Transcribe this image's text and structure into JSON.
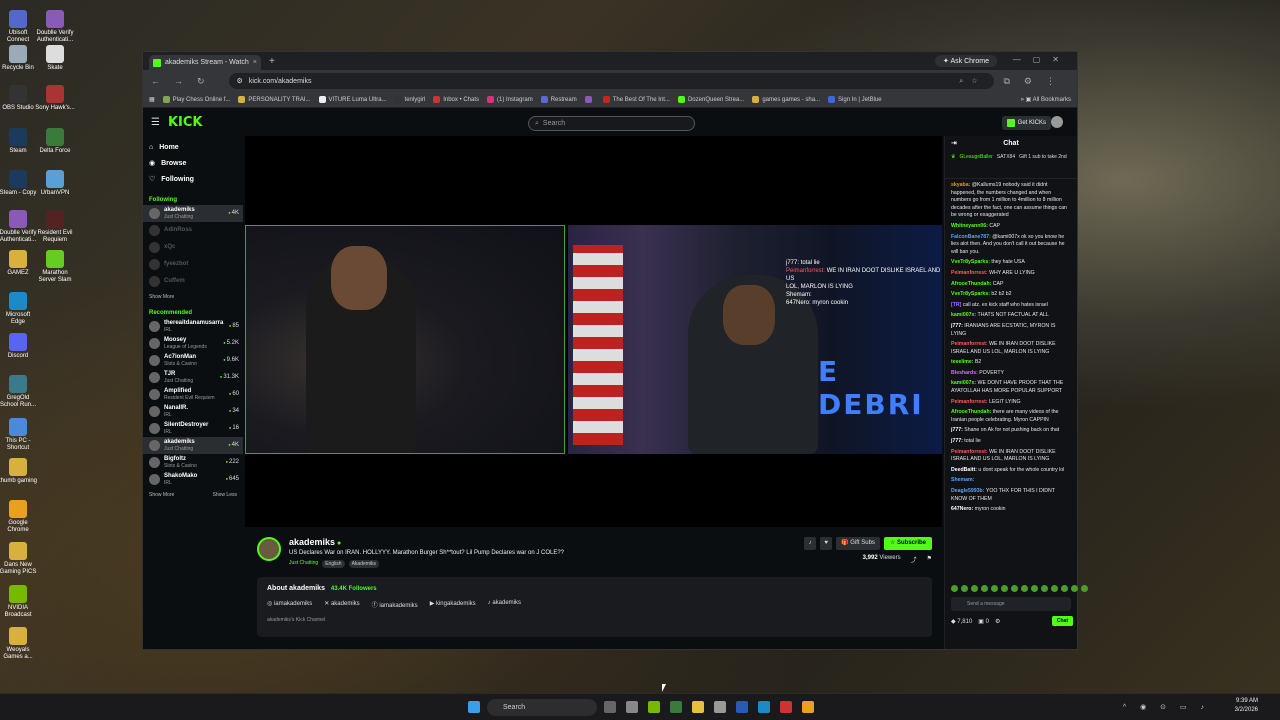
{
  "desktop_icons": [
    {
      "label": "Ubisoft Connect",
      "color": "#5468c9"
    },
    {
      "label": "Doublle Verify Authenticati...",
      "color": "#8a5ab8"
    },
    {
      "label": "Recycle Bin",
      "color": "#9aaab8"
    },
    {
      "label": "Skate",
      "color": "#ddd"
    },
    {
      "label": "OBS Studio",
      "color": "#333"
    },
    {
      "label": "Sony Hawk's...",
      "color": "#aa3333"
    },
    {
      "label": "Steam",
      "color": "#1b3a5c"
    },
    {
      "label": "Delta Force",
      "color": "#3a7a3a"
    },
    {
      "label": "Steam - Copy",
      "color": "#1b3a5c"
    },
    {
      "label": "UrbanVPN",
      "color": "#5aa0d8"
    },
    {
      "label": "Doublle Verify Authenticati...",
      "color": "#8a5ab8"
    },
    {
      "label": "Resident Evil Requiem",
      "color": "#552222"
    },
    {
      "label": "GAMEZ",
      "color": "#d8b040"
    },
    {
      "label": "Marathon Server Slam",
      "color": "#66cc22"
    },
    {
      "label": "Microsoft Edge",
      "color": "#1d8ac8"
    },
    {
      "label": "Discord",
      "color": "#5865f2"
    },
    {
      "label": "GregOld School Run...",
      "color": "#3a7a8a"
    },
    {
      "label": "This PC - Shortcut",
      "color": "#4a8ad8"
    },
    {
      "label": "thumb gaming",
      "color": "#d8b040"
    },
    {
      "label": "Google Chrome",
      "color": "#e8a020"
    },
    {
      "label": "Dans New Gaming PICS",
      "color": "#d8b040"
    },
    {
      "label": "NVIDIA Broadcast",
      "color": "#76b900"
    },
    {
      "label": "Weoyals Games a...",
      "color": "#d8b040"
    }
  ],
  "browser": {
    "tab_title": "akademiks Stream - Watch",
    "ask_chrome": "Ask Chrome",
    "url": "kick.com/akademiks",
    "bookmarks": [
      {
        "label": "Play Chess Online f...",
        "color": "#7fa650"
      },
      {
        "label": "PERSONALITY TRAI...",
        "color": "#d8b040"
      },
      {
        "label": "VITURE Luma Ultra...",
        "color": "#eee"
      },
      {
        "label": "tenlygirl",
        "color": "#333"
      },
      {
        "label": "Inbox • Chats",
        "color": "#c33"
      },
      {
        "label": "(1) Instagram",
        "color": "#d6337a"
      },
      {
        "label": "Restream",
        "color": "#5a6ad8"
      },
      {
        "label": "",
        "color": "#8a5ab8"
      },
      {
        "label": "The Best Of The Int...",
        "color": "#c22"
      },
      {
        "label": "DozenQueen Strea...",
        "color": "#53fc18"
      },
      {
        "label": "games games - sha...",
        "color": "#d8b040"
      },
      {
        "label": "Sign In | JetBlue",
        "color": "#3a6ad8"
      }
    ],
    "all_bookmarks": "All Bookmarks"
  },
  "kick": {
    "logo": "KICK",
    "search_placeholder": "Search",
    "get_kicks": "Get KICKs",
    "nav": {
      "home": "Home",
      "browse": "Browse",
      "following": "Following"
    },
    "following_header": "Following",
    "following": [
      {
        "name": "akademiks",
        "cat": "Just Chatting",
        "viewers": "4K",
        "dim": false
      },
      {
        "name": "AdinRoss",
        "cat": "",
        "viewers": "",
        "dim": true
      },
      {
        "name": "xQc",
        "cat": "",
        "viewers": "",
        "dim": true
      },
      {
        "name": "fyeezbot",
        "cat": "",
        "viewers": "",
        "dim": true
      },
      {
        "name": "Cuffem",
        "cat": "",
        "viewers": "",
        "dim": true
      }
    ],
    "show_more": "Show More",
    "recommended_header": "Recommended",
    "recommended": [
      {
        "name": "thereaitdanamusarra",
        "cat": "IRL",
        "viewers": "85"
      },
      {
        "name": "Moosey",
        "cat": "League of Legends",
        "viewers": "5.2K"
      },
      {
        "name": "Ac7ionMan",
        "cat": "Slots & Casino",
        "viewers": "9.6K"
      },
      {
        "name": "TJR",
        "cat": "Just Chatting",
        "viewers": "31.3K"
      },
      {
        "name": "Amplified",
        "cat": "Resident Evil Requiem",
        "viewers": "60"
      },
      {
        "name": "NanaIIR.",
        "cat": "IRL",
        "viewers": "34"
      },
      {
        "name": "SilentDestroyer",
        "cat": "IRL",
        "viewers": "16"
      },
      {
        "name": "akademiks",
        "cat": "Just Chatting",
        "viewers": "4K"
      },
      {
        "name": "Bigfoltz",
        "cat": "Slots & Casino",
        "viewers": "222"
      },
      {
        "name": "ShakoMako",
        "cat": "IRL",
        "viewers": "645"
      }
    ],
    "show_more2": "Show More",
    "show_less": "Show Less",
    "overlay": {
      "l1": "j777: total lie",
      "l2a": "Peimanforrest:",
      "l2b": "WE IN IRAN DOOT DISLIKE ISRAEL AND US",
      "l3": "LOL, MARLON IS LYING",
      "l4": "Shemam:",
      "l5": "647Nero: myron cookin"
    },
    "neon_text": "E DEBRI",
    "streamer": "akademiks",
    "title": "US Declares War on IRAN. HOLLYYY. Marathon Burger Sh**tout? Lil Pump Declares war on J COLE??",
    "category": "Just Chatting",
    "tags": [
      "English",
      "Akademiks"
    ],
    "gift_subs": "Gift Subs",
    "subscribe": "Subscribe",
    "viewers": "3,992",
    "viewers_label": "Viewers",
    "about_title": "About akademiks",
    "followers": "43.4K",
    "followers_label": "Followers",
    "socials": [
      "iamakademiks",
      "akademiks",
      "iamakademiks",
      "kingakademiks",
      "akademiks"
    ],
    "about_text": "akademiks's Kick Channel",
    "chat": {
      "header": "Chat",
      "pin_user": "GLeaugeBaller",
      "pin_user2": "SATX84",
      "pin_text": "Gift 1 sub to take 2nd",
      "messages": [
        {
          "u": "skyaba:",
          "c": "#d8a020",
          "t": "@Kallums19 nobody said it didnt happened, the numbers changed and when numbers go from 1 million to 4million to 8 million decades after the fact, one can assume things can be wrong or exaggerated"
        },
        {
          "u": "Whitneyann06:",
          "c": "#53fc18",
          "t": "CAP"
        },
        {
          "u": "FalconBane787:",
          "c": "#4aa8ff",
          "t": "@kami007x ok so you know he lies alot then. And you don't call it out because he will ban you."
        },
        {
          "u": "VveTr8ySparks:",
          "c": "#53fc18",
          "t": "they hate USA"
        },
        {
          "u": "Peimanforrest:",
          "c": "#ff5a5a",
          "t": "WHY ARE U LYING"
        },
        {
          "u": "AfrooeThundah:",
          "c": "#53fc18",
          "t": "CAP"
        },
        {
          "u": "VveTr8ySparks:",
          "c": "#53fc18",
          "t": "b2 b2 b2"
        },
        {
          "u": "[TR]",
          "c": "#aa66ff",
          "t": "call atz. ex kick staff who hates israel"
        },
        {
          "u": "kami007x:",
          "c": "#53fc18",
          "t": "THATS NOT FACTUAL AT ALL"
        },
        {
          "u": "j777:",
          "c": "#ffffff",
          "t": "IRANIANS ARE ECSTATIC, MYRON IS LYING"
        },
        {
          "u": "Peimanforrest:",
          "c": "#ff5a5a",
          "t": "WE IN IRAN DOOT DISLIKE ISRAEL AND US LOL, MARLON IS LYING"
        },
        {
          "u": "teeelime:",
          "c": "#53fc18",
          "t": "B2"
        },
        {
          "u": "Bleshards:",
          "c": "#d86aff",
          "t": "POVERTY"
        },
        {
          "u": "kami007x:",
          "c": "#53fc18",
          "t": "WE DONT HAVE PROOF THAT THE AYATOLLAH HAS MORE POPULAR SUPPORT"
        },
        {
          "u": "Peimanforrest:",
          "c": "#ff5a5a",
          "t": "LEGIT LYING"
        },
        {
          "u": "AfrooeThundah:",
          "c": "#53fc18",
          "t": "there are many videos of the Iranian people celebrating. Myron CAPPIN"
        },
        {
          "u": "j777:",
          "c": "#ffffff",
          "t": "Shane on Ak for not pushing back on that"
        },
        {
          "u": "j777:",
          "c": "#ffffff",
          "t": "total lie"
        },
        {
          "u": "Peimanforrest:",
          "c": "#ff5a5a",
          "t": "WE IN IRAN DOOT DISLIKE ISRAEL AND US LOL, MARLON IS LYING"
        },
        {
          "u": "DeedBaitt:",
          "c": "#ffffff",
          "t": "u dont speak for the whole country lol"
        },
        {
          "u": "Shemam:",
          "c": "#4aa8ff",
          "t": ""
        },
        {
          "u": "Deagle5993b:",
          "c": "#4aa8ff",
          "t": "YOO THX FOR THIS I DIDNT KNOW OF THEM"
        },
        {
          "u": "647Nero:",
          "c": "#ffffff",
          "t": "myron cookin"
        }
      ],
      "send_placeholder": "Send a message",
      "kicks": "7,810",
      "points": "0",
      "chat_btn": "Chat"
    }
  },
  "taskbar": {
    "search": "Search",
    "time": "9:39 AM",
    "date": "3/2/2026"
  }
}
